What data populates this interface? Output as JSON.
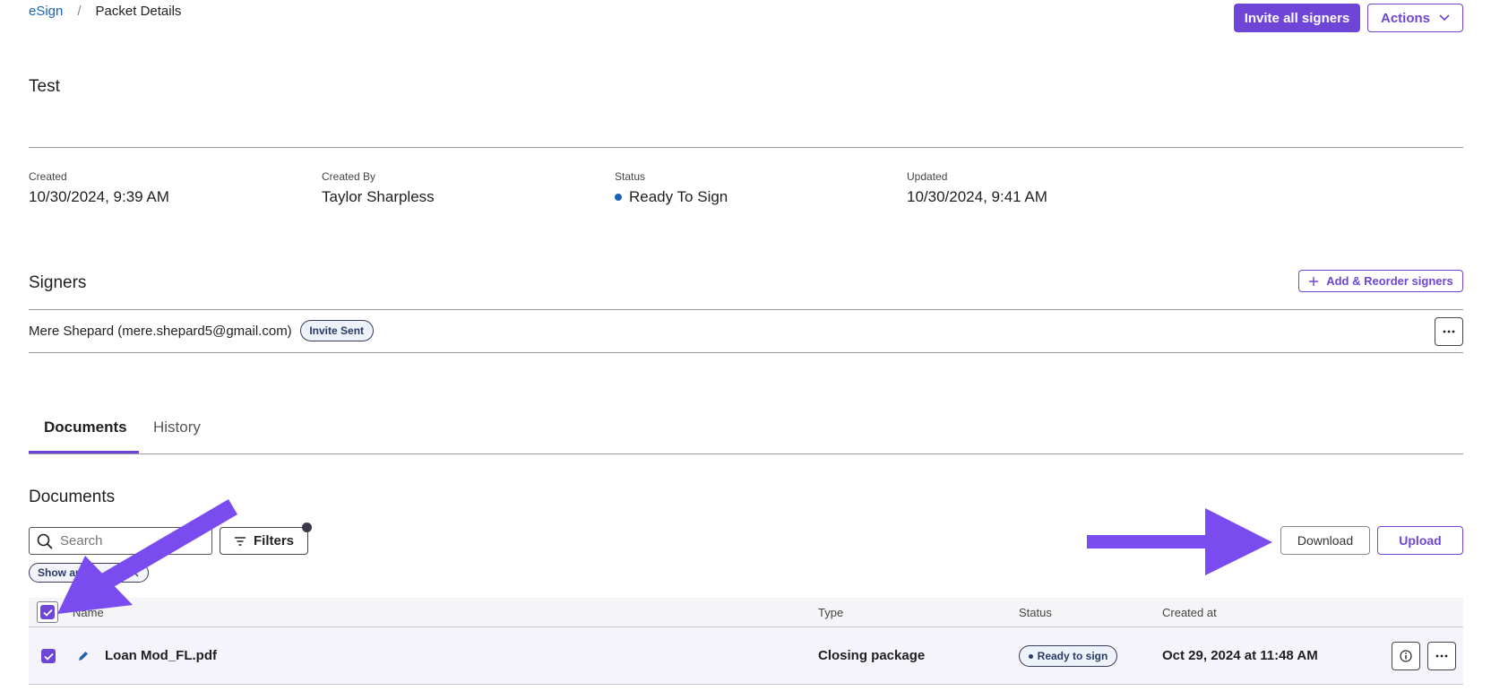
{
  "breadcrumb": {
    "root": "eSign",
    "separator": "/",
    "current": "Packet Details"
  },
  "header": {
    "invite_all_label": "Invite all signers",
    "actions_label": "Actions"
  },
  "packet": {
    "title": "Test"
  },
  "meta": [
    {
      "label": "Created",
      "value": "10/30/2024, 9:39 AM"
    },
    {
      "label": "Created By",
      "value": "Taylor Sharpless"
    },
    {
      "label": "Status",
      "value": "Ready To Sign"
    },
    {
      "label": "Updated",
      "value": "10/30/2024, 9:41 AM"
    }
  ],
  "signers": {
    "title": "Signers",
    "add_label": "Add & Reorder signers",
    "items": [
      {
        "name": "Mere Shepard (mere.shepard5@gmail.com)",
        "badge": "Invite Sent"
      }
    ]
  },
  "tabs": [
    {
      "label": "Documents"
    },
    {
      "label": "History"
    }
  ],
  "documents": {
    "title": "Documents",
    "search_placeholder": "Search",
    "filters_label": "Filters",
    "chip_label": "Show au",
    "download_label": "Download",
    "upload_label": "Upload",
    "columns": {
      "name": "Name",
      "type": "Type",
      "status": "Status",
      "created": "Created at"
    },
    "rows": [
      {
        "name": "Loan Mod_FL.pdf",
        "type": "Closing package",
        "status": "Ready to sign",
        "created": "Oct 29, 2024 at 11:48 AM"
      }
    ]
  },
  "colors": {
    "accent": "#6e45d6",
    "link": "#1a63b8",
    "status_dot": "#1a63b8",
    "arrow": "#7a4cf0"
  },
  "icons": {
    "chevron": "chevron-down-icon",
    "plus": "plus-icon",
    "more": "more-horizontal-icon",
    "search": "search-icon",
    "filter": "filter-icon",
    "close": "close-icon",
    "check": "check-icon",
    "edit": "pencil-icon",
    "info": "info-icon",
    "arrow": "annotation-arrow"
  }
}
